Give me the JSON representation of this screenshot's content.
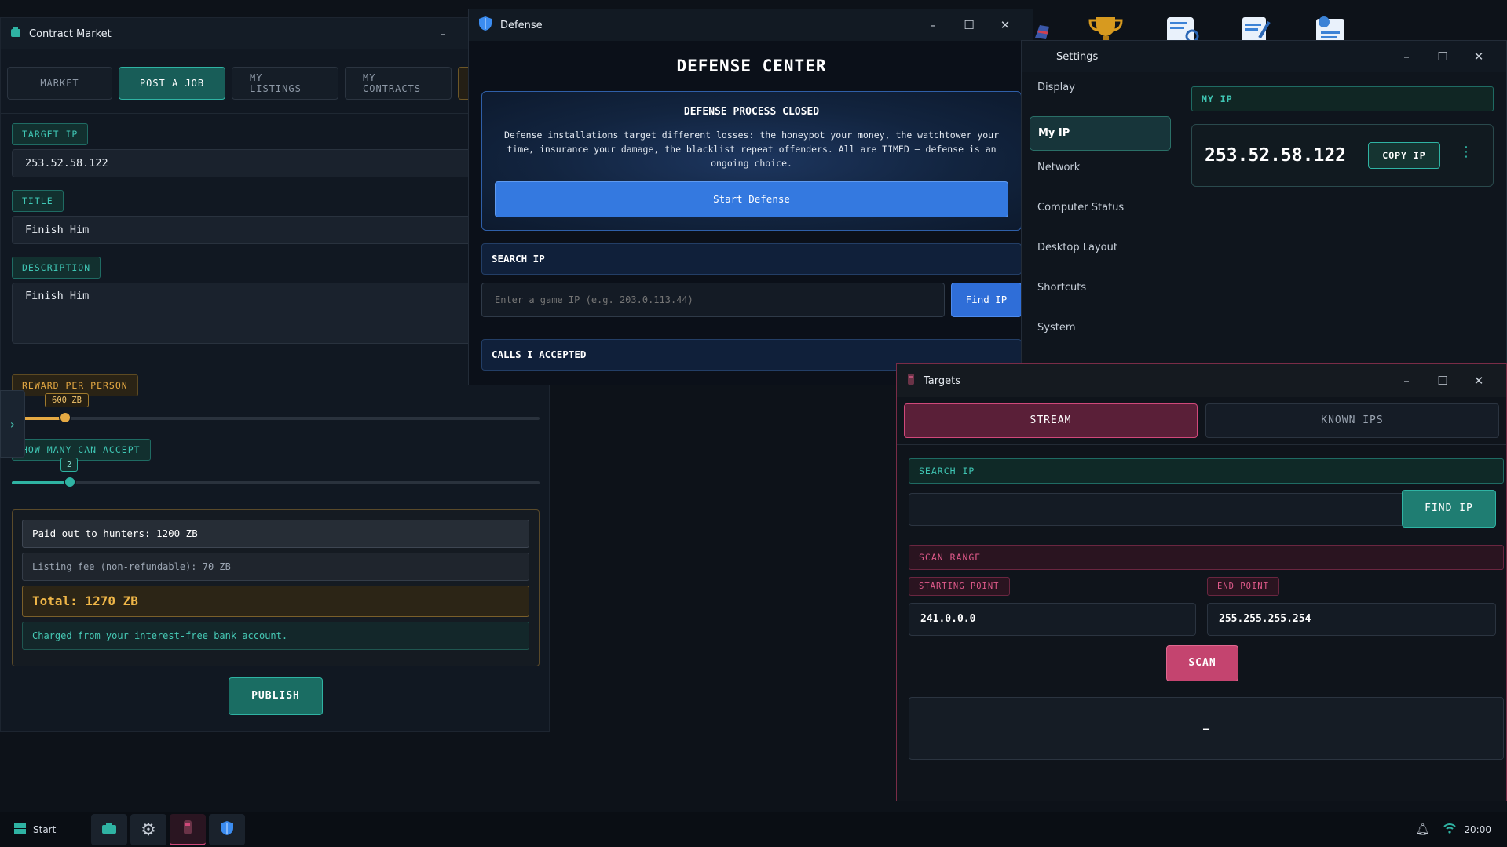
{
  "contract_market": {
    "title": "Contract Market",
    "tabs": [
      "MARKET",
      "POST A JOB",
      "MY LISTINGS",
      "MY CONTRACTS"
    ],
    "target_ip_label": "TARGET IP",
    "target_ip_value": "253.52.58.122",
    "title_label": "TITLE",
    "title_value": "Finish Him",
    "description_label": "DESCRIPTION",
    "description_value": "Finish Him",
    "reward_label": "REWARD PER PERSON",
    "reward_value": "600 ZB",
    "how_many_label": "HOW MANY CAN ACCEPT",
    "how_many_value": "2",
    "summary": {
      "paid_out": "Paid out to hunters: 1200 ZB",
      "listing_fee": "Listing fee (non-refundable): 70 ZB",
      "total": "Total: 1270 ZB",
      "charged": "Charged from your interest-free bank account."
    },
    "publish_label": "PUBLISH"
  },
  "defense": {
    "title": "Defense",
    "heading": "DEFENSE CENTER",
    "process_title": "DEFENSE PROCESS CLOSED",
    "process_text": "Defense installations target different losses: the honeypot your money, the watchtower your time, insurance your damage, the blacklist repeat offenders. All are TIMED — defense is an ongoing choice.",
    "start_label": "Start Defense",
    "search_ip_label": "SEARCH IP",
    "search_placeholder": "Enter a game IP (e.g. 203.0.113.44)",
    "find_ip_label": "Find IP",
    "calls_label": "CALLS I ACCEPTED"
  },
  "settings": {
    "title": "Settings",
    "nav": [
      "Display",
      "My IP",
      "Network",
      "Computer Status",
      "Desktop Layout",
      "Shortcuts",
      "System"
    ],
    "my_ip_label": "MY IP",
    "ip_value": "253.52.58.122",
    "copy_label": "COPY IP"
  },
  "targets": {
    "title": "Targets",
    "tabs": [
      "STREAM",
      "KNOWN IPS"
    ],
    "search_ip_label": "SEARCH IP",
    "find_ip_label": "FIND IP",
    "scan_range_label": "SCAN RANGE",
    "start_label": "STARTING POINT",
    "start_value": "241.0.0.0",
    "end_label": "END POINT",
    "end_value": "255.255.255.254",
    "scan_label": "SCAN",
    "result_text": "–"
  },
  "taskbar": {
    "start_label": "Start",
    "clock": "20:00"
  },
  "colors": {
    "accent_teal": "#2fb3a3",
    "accent_gold": "#e5a943",
    "accent_blue": "#2f78e0",
    "accent_pink": "#d0487a"
  }
}
